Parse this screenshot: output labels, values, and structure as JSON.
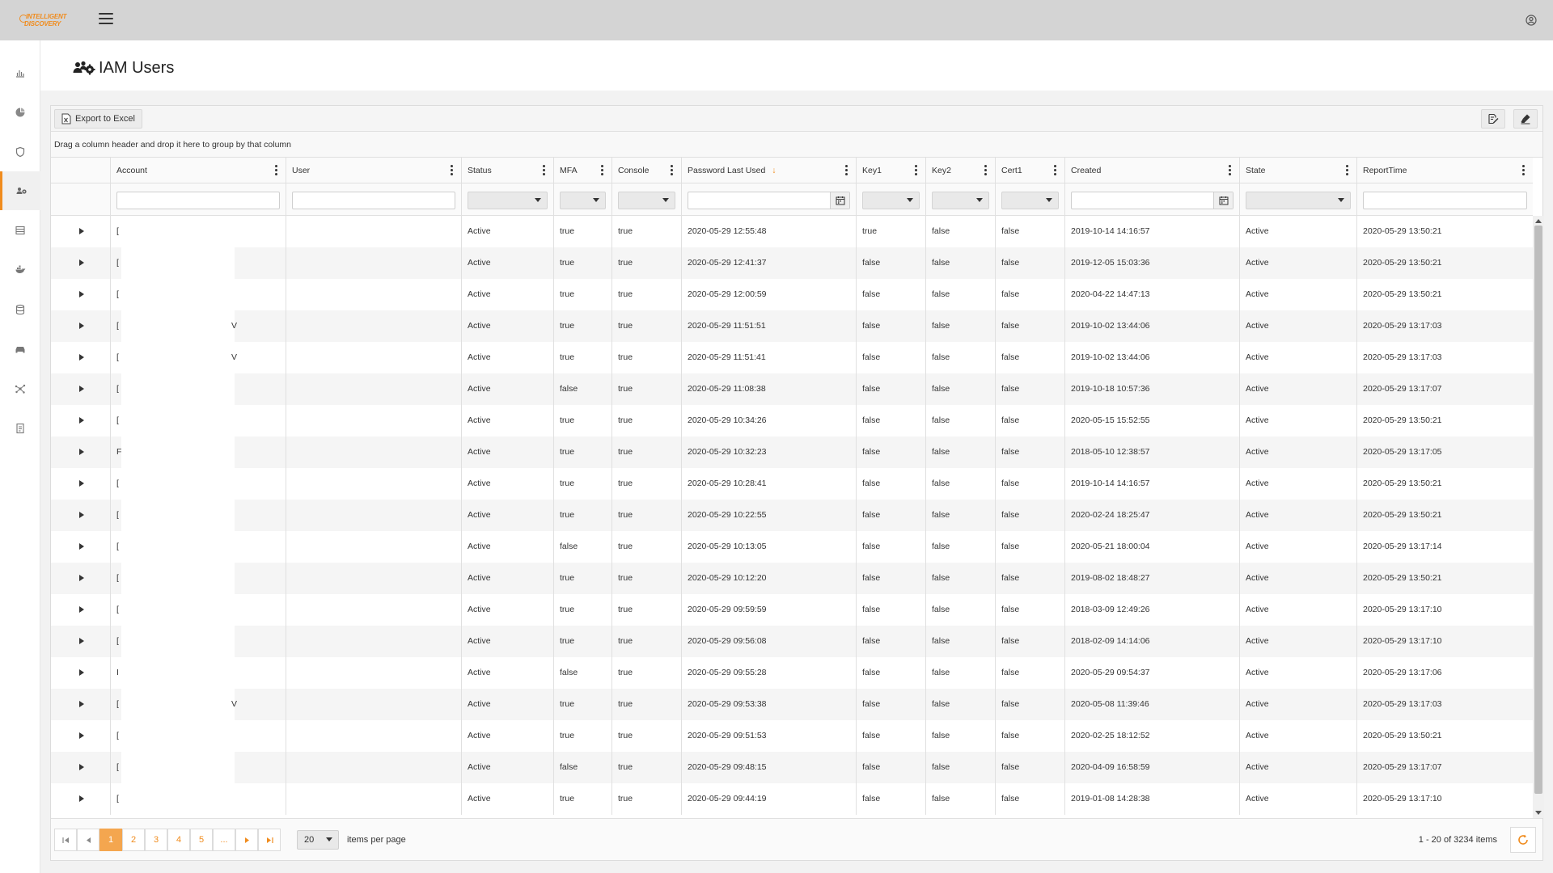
{
  "app": {
    "logo_line1": "INTELLIGENT",
    "logo_line2": "DISCOVERY",
    "accent_color": "#f08c1e"
  },
  "sidebar": {
    "items": [
      {
        "name": "reports-icon"
      },
      {
        "name": "pie-chart-icon"
      },
      {
        "name": "shield-icon"
      },
      {
        "name": "users-gear-icon",
        "active": true
      },
      {
        "name": "table-icon"
      },
      {
        "name": "whale-icon"
      },
      {
        "name": "database-icon"
      },
      {
        "name": "car-icon"
      },
      {
        "name": "network-icon"
      },
      {
        "name": "document-icon"
      }
    ]
  },
  "page": {
    "title": "IAM Users",
    "title_icon": "users-gear-icon"
  },
  "toolbar": {
    "export_label": "Export to Excel"
  },
  "group_panel": {
    "hint": "Drag a column header and drop it here to group by that column"
  },
  "columns": [
    {
      "key": "account",
      "label": "Account",
      "filter": "text"
    },
    {
      "key": "user",
      "label": "User",
      "filter": "text"
    },
    {
      "key": "status",
      "label": "Status",
      "filter": "select"
    },
    {
      "key": "mfa",
      "label": "MFA",
      "filter": "select"
    },
    {
      "key": "console",
      "label": "Console",
      "filter": "select"
    },
    {
      "key": "pwd",
      "label": "Password Last Used",
      "filter": "date",
      "sort": "desc"
    },
    {
      "key": "key1",
      "label": "Key1",
      "filter": "select"
    },
    {
      "key": "key2",
      "label": "Key2",
      "filter": "select"
    },
    {
      "key": "cert1",
      "label": "Cert1",
      "filter": "select"
    },
    {
      "key": "created",
      "label": "Created",
      "filter": "date"
    },
    {
      "key": "state",
      "label": "State",
      "filter": "select"
    },
    {
      "key": "report",
      "label": "ReportTime",
      "filter": "text"
    }
  ],
  "rows": [
    {
      "account": "[",
      "extra": "",
      "status": "Active",
      "mfa": "true",
      "console": "true",
      "pwd": "2020-05-29 12:55:48",
      "key1": "true",
      "key2": "false",
      "cert1": "false",
      "created": "2019-10-14 14:16:57",
      "state": "Active",
      "report": "2020-05-29 13:50:21"
    },
    {
      "account": "[",
      "extra": "",
      "status": "Active",
      "mfa": "true",
      "console": "true",
      "pwd": "2020-05-29 12:41:37",
      "key1": "false",
      "key2": "false",
      "cert1": "false",
      "created": "2019-12-05 15:03:36",
      "state": "Active",
      "report": "2020-05-29 13:50:21"
    },
    {
      "account": "[",
      "extra": "",
      "status": "Active",
      "mfa": "true",
      "console": "true",
      "pwd": "2020-05-29 12:00:59",
      "key1": "false",
      "key2": "false",
      "cert1": "false",
      "created": "2020-04-22 14:47:13",
      "state": "Active",
      "report": "2020-05-29 13:50:21"
    },
    {
      "account": "[",
      "extra": "V",
      "status": "Active",
      "mfa": "true",
      "console": "true",
      "pwd": "2020-05-29 11:51:51",
      "key1": "false",
      "key2": "false",
      "cert1": "false",
      "created": "2019-10-02 13:44:06",
      "state": "Active",
      "report": "2020-05-29 13:17:03"
    },
    {
      "account": "[",
      "extra": "V",
      "status": "Active",
      "mfa": "true",
      "console": "true",
      "pwd": "2020-05-29 11:51:41",
      "key1": "false",
      "key2": "false",
      "cert1": "false",
      "created": "2019-10-02 13:44:06",
      "state": "Active",
      "report": "2020-05-29 13:17:03"
    },
    {
      "account": "[",
      "extra": "",
      "status": "Active",
      "mfa": "false",
      "console": "true",
      "pwd": "2020-05-29 11:08:38",
      "key1": "false",
      "key2": "false",
      "cert1": "false",
      "created": "2019-10-18 10:57:36",
      "state": "Active",
      "report": "2020-05-29 13:17:07"
    },
    {
      "account": "[",
      "extra": "",
      "status": "Active",
      "mfa": "true",
      "console": "true",
      "pwd": "2020-05-29 10:34:26",
      "key1": "false",
      "key2": "false",
      "cert1": "false",
      "created": "2020-05-15 15:52:55",
      "state": "Active",
      "report": "2020-05-29 13:50:21"
    },
    {
      "account": "F",
      "extra": "",
      "status": "Active",
      "mfa": "true",
      "console": "true",
      "pwd": "2020-05-29 10:32:23",
      "key1": "false",
      "key2": "false",
      "cert1": "false",
      "created": "2018-05-10 12:38:57",
      "state": "Active",
      "report": "2020-05-29 13:17:05"
    },
    {
      "account": "[",
      "extra": "",
      "status": "Active",
      "mfa": "true",
      "console": "true",
      "pwd": "2020-05-29 10:28:41",
      "key1": "false",
      "key2": "false",
      "cert1": "false",
      "created": "2019-10-14 14:16:57",
      "state": "Active",
      "report": "2020-05-29 13:50:21"
    },
    {
      "account": "[",
      "extra": "",
      "status": "Active",
      "mfa": "true",
      "console": "true",
      "pwd": "2020-05-29 10:22:55",
      "key1": "false",
      "key2": "false",
      "cert1": "false",
      "created": "2020-02-24 18:25:47",
      "state": "Active",
      "report": "2020-05-29 13:50:21"
    },
    {
      "account": "[",
      "extra": "",
      "status": "Active",
      "mfa": "false",
      "console": "true",
      "pwd": "2020-05-29 10:13:05",
      "key1": "false",
      "key2": "false",
      "cert1": "false",
      "created": "2020-05-21 18:00:04",
      "state": "Active",
      "report": "2020-05-29 13:17:14"
    },
    {
      "account": "[",
      "extra": "",
      "status": "Active",
      "mfa": "true",
      "console": "true",
      "pwd": "2020-05-29 10:12:20",
      "key1": "false",
      "key2": "false",
      "cert1": "false",
      "created": "2019-08-02 18:48:27",
      "state": "Active",
      "report": "2020-05-29 13:50:21"
    },
    {
      "account": "[",
      "extra": "",
      "status": "Active",
      "mfa": "true",
      "console": "true",
      "pwd": "2020-05-29 09:59:59",
      "key1": "false",
      "key2": "false",
      "cert1": "false",
      "created": "2018-03-09 12:49:26",
      "state": "Active",
      "report": "2020-05-29 13:17:10"
    },
    {
      "account": "[",
      "extra": "",
      "status": "Active",
      "mfa": "true",
      "console": "true",
      "pwd": "2020-05-29 09:56:08",
      "key1": "false",
      "key2": "false",
      "cert1": "false",
      "created": "2018-02-09 14:14:06",
      "state": "Active",
      "report": "2020-05-29 13:17:10"
    },
    {
      "account": "I",
      "extra": "",
      "status": "Active",
      "mfa": "false",
      "console": "true",
      "pwd": "2020-05-29 09:55:28",
      "key1": "false",
      "key2": "false",
      "cert1": "false",
      "created": "2020-05-29 09:54:37",
      "state": "Active",
      "report": "2020-05-29 13:17:06"
    },
    {
      "account": "[",
      "extra": "V",
      "status": "Active",
      "mfa": "true",
      "console": "true",
      "pwd": "2020-05-29 09:53:38",
      "key1": "false",
      "key2": "false",
      "cert1": "false",
      "created": "2020-05-08 11:39:46",
      "state": "Active",
      "report": "2020-05-29 13:17:03"
    },
    {
      "account": "[",
      "extra": "",
      "status": "Active",
      "mfa": "true",
      "console": "true",
      "pwd": "2020-05-29 09:51:53",
      "key1": "false",
      "key2": "false",
      "cert1": "false",
      "created": "2020-02-25 18:12:52",
      "state": "Active",
      "report": "2020-05-29 13:50:21"
    },
    {
      "account": "[",
      "extra": "",
      "status": "Active",
      "mfa": "false",
      "console": "true",
      "pwd": "2020-05-29 09:48:15",
      "key1": "false",
      "key2": "false",
      "cert1": "false",
      "created": "2020-04-09 16:58:59",
      "state": "Active",
      "report": "2020-05-29 13:17:07"
    },
    {
      "account": "[",
      "extra": "",
      "status": "Active",
      "mfa": "true",
      "console": "true",
      "pwd": "2020-05-29 09:44:19",
      "key1": "false",
      "key2": "false",
      "cert1": "false",
      "created": "2019-01-08 14:28:38",
      "state": "Active",
      "report": "2020-05-29 13:17:10"
    }
  ],
  "pager": {
    "pages": [
      "1",
      "2",
      "3",
      "4",
      "5",
      "..."
    ],
    "current_page": "1",
    "page_size": "20",
    "items_per_page_label": "items per page",
    "info": "1 - 20 of 3234 items"
  }
}
